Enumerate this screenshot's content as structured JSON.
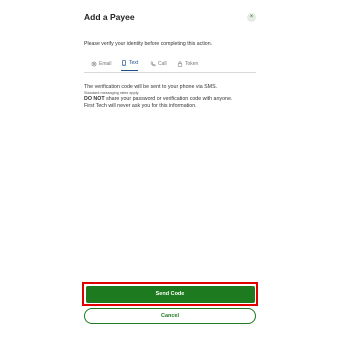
{
  "dialog": {
    "title": "Add a Payee",
    "close_label": "×",
    "instruction": "Please verify your identity before completing this action."
  },
  "tabs": [
    {
      "label": "Email",
      "icon": "email-icon",
      "active": false
    },
    {
      "label": "Text",
      "icon": "phone-icon",
      "active": true
    },
    {
      "label": "Call",
      "icon": "call-icon",
      "active": false
    },
    {
      "label": "Token",
      "icon": "lock-icon",
      "active": false
    }
  ],
  "message": {
    "line1": "The verification code will be sent to your phone via SMS.",
    "line2": "Standard messaging rates apply.",
    "line3_bold": "DO NOT",
    "line3_rest": " share your password or verification code with anyone.",
    "line4": "First Tech will never ask you for this information."
  },
  "buttons": {
    "send_label": "Send Code",
    "cancel_label": "Cancel"
  },
  "colors": {
    "primary_green": "#1d7a1f",
    "active_tab_blue": "#1f4e8c",
    "highlight_red": "#e10000"
  }
}
